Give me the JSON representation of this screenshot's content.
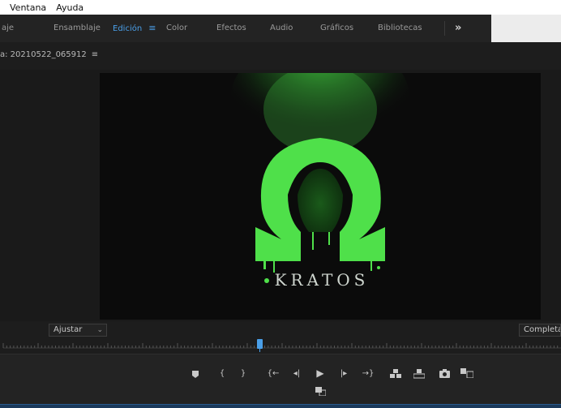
{
  "menubar": {
    "items": [
      "Ventana",
      "Ayuda"
    ]
  },
  "workspaces": {
    "tabs": [
      "aje",
      "Ensamblaje",
      "Edición",
      "Color",
      "Efectos",
      "Audio",
      "Gráficos",
      "Bibliotecas"
    ],
    "active": "Edición",
    "more": "»"
  },
  "program_monitor": {
    "title": "a: 20210522_065912",
    "menu_icon": "hamburger-icon",
    "video_caption": "KRATOS",
    "accent_green": "#4fe04a",
    "fit": {
      "value": "Ajustar"
    },
    "quality": {
      "value": "Completa"
    }
  },
  "transport": {
    "buttons": [
      "add-marker-icon",
      "mark-in-icon",
      "mark-out-icon",
      "go-to-in-icon",
      "step-back-icon",
      "play-icon",
      "step-forward-icon",
      "go-to-out-icon",
      "insert-icon",
      "overwrite-icon",
      "export-frame-icon",
      "compare-view-icon",
      "button-editor-icon"
    ]
  },
  "colors": {
    "accent": "#4a9fe8",
    "background": "#1d1d1d"
  }
}
